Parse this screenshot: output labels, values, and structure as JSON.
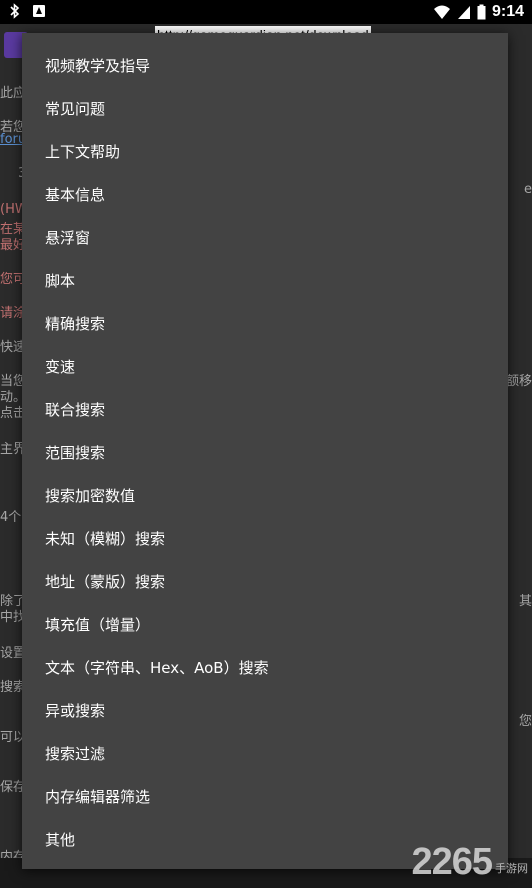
{
  "statusbar": {
    "time": "9:14",
    "icons": [
      "bluetooth-icon",
      "notification-icon",
      "wifi-icon",
      "signal-icon",
      "battery-icon"
    ]
  },
  "background": {
    "url": "http://gameguardian.net/download"
  },
  "menu": {
    "items": [
      "视频教学及指导",
      "常见问题",
      "上下文帮助",
      "基本信息",
      "悬浮窗",
      "脚本",
      "精确搜索",
      "变速",
      "联合搜索",
      "范围搜索",
      "搜索加密数值",
      "未知（模糊）搜索",
      "地址（蒙版）搜索",
      "填充值（增量）",
      "文本（字符串、Hex、AoB）搜索",
      "异或搜索",
      "搜索过滤",
      "内存编辑器筛选",
      "其他"
    ]
  },
  "watermark": {
    "number": "2265",
    "text": "手游网"
  }
}
